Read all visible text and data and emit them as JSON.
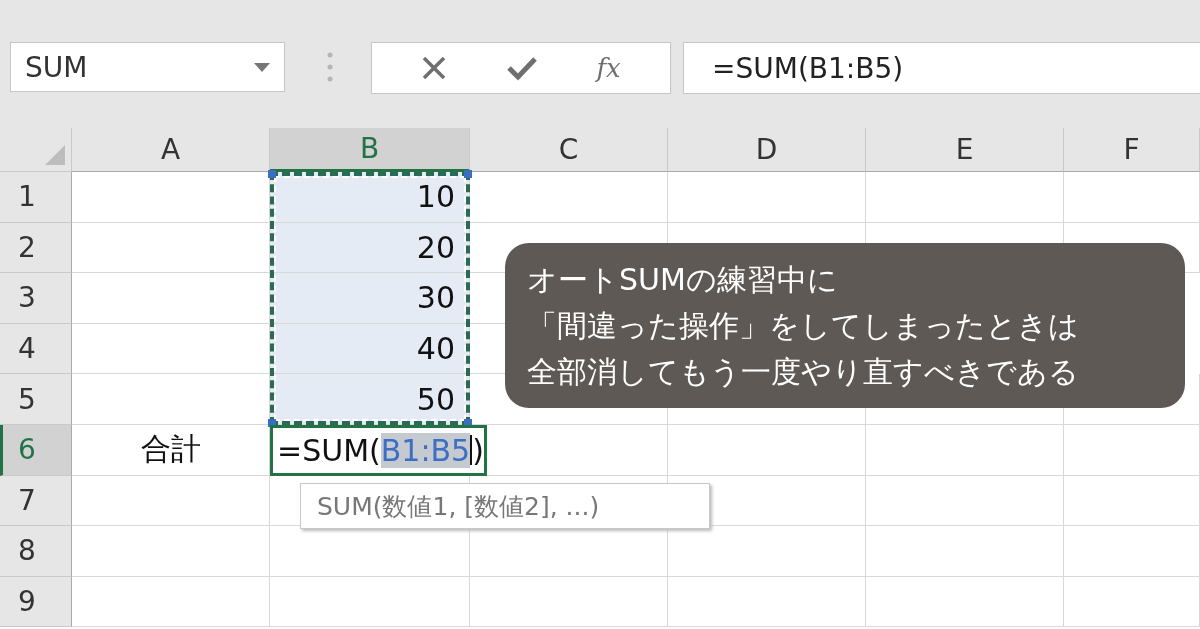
{
  "name_box": {
    "value": "SUM"
  },
  "formula_bar": {
    "fx_label": "fx",
    "value": "=SUM(B1:B5)"
  },
  "columns": [
    {
      "label": "A",
      "selected": false
    },
    {
      "label": "B",
      "selected": true
    },
    {
      "label": "C",
      "selected": false
    },
    {
      "label": "D",
      "selected": false
    },
    {
      "label": "E",
      "selected": false
    },
    {
      "label": "F",
      "selected": false
    }
  ],
  "rows": [
    {
      "label": "1",
      "selected": false,
      "in_range": true,
      "cells": [
        {
          "kind": "empty"
        },
        {
          "kind": "value",
          "text": "10"
        },
        {
          "kind": "empty"
        },
        {
          "kind": "empty"
        },
        {
          "kind": "empty"
        },
        {
          "kind": "empty"
        }
      ]
    },
    {
      "label": "2",
      "selected": false,
      "in_range": true,
      "cells": [
        {
          "kind": "empty"
        },
        {
          "kind": "value",
          "text": "20"
        },
        {
          "kind": "empty"
        },
        {
          "kind": "empty"
        },
        {
          "kind": "empty"
        },
        {
          "kind": "empty"
        }
      ]
    },
    {
      "label": "3",
      "selected": false,
      "in_range": true,
      "cells": [
        {
          "kind": "empty"
        },
        {
          "kind": "value",
          "text": "30"
        },
        {
          "kind": "empty"
        },
        {
          "kind": "covered"
        },
        {
          "kind": "covered"
        },
        {
          "kind": "empty"
        }
      ]
    },
    {
      "label": "4",
      "selected": false,
      "in_range": true,
      "cells": [
        {
          "kind": "empty"
        },
        {
          "kind": "value",
          "text": "40"
        },
        {
          "kind": "empty"
        },
        {
          "kind": "covered"
        },
        {
          "kind": "covered"
        },
        {
          "kind": "empty"
        }
      ]
    },
    {
      "label": "5",
      "selected": false,
      "in_range": true,
      "cells": [
        {
          "kind": "empty"
        },
        {
          "kind": "value",
          "text": "50"
        },
        {
          "kind": "empty"
        },
        {
          "kind": "empty"
        },
        {
          "kind": "empty"
        },
        {
          "kind": "empty"
        }
      ]
    },
    {
      "label": "6",
      "selected": true,
      "in_range": false,
      "cells": [
        {
          "kind": "label",
          "text": "合計"
        },
        {
          "kind": "edit",
          "prefix": "=SUM(",
          "ref": "B1:B5",
          "suffix": ")"
        },
        {
          "kind": "empty"
        },
        {
          "kind": "empty"
        },
        {
          "kind": "empty"
        },
        {
          "kind": "empty"
        }
      ]
    },
    {
      "label": "7",
      "selected": false,
      "in_range": false,
      "cells": [
        {
          "kind": "empty"
        },
        {
          "kind": "empty"
        },
        {
          "kind": "empty"
        },
        {
          "kind": "empty"
        },
        {
          "kind": "empty"
        },
        {
          "kind": "empty"
        }
      ]
    },
    {
      "label": "8",
      "selected": false,
      "in_range": false,
      "cells": [
        {
          "kind": "empty"
        },
        {
          "kind": "empty"
        },
        {
          "kind": "empty"
        },
        {
          "kind": "empty"
        },
        {
          "kind": "empty"
        },
        {
          "kind": "empty"
        }
      ]
    },
    {
      "label": "9",
      "selected": false,
      "in_range": false,
      "cells": [
        {
          "kind": "empty"
        },
        {
          "kind": "empty"
        },
        {
          "kind": "empty"
        },
        {
          "kind": "empty"
        },
        {
          "kind": "empty"
        },
        {
          "kind": "empty"
        }
      ]
    }
  ],
  "tooltip": "SUM(数値1, [数値2], ...)",
  "callout": [
    "オートSUMの練習中に",
    "「間違った操作」をしてしまったときは",
    "全部消してもう一度やり直すべきである"
  ]
}
